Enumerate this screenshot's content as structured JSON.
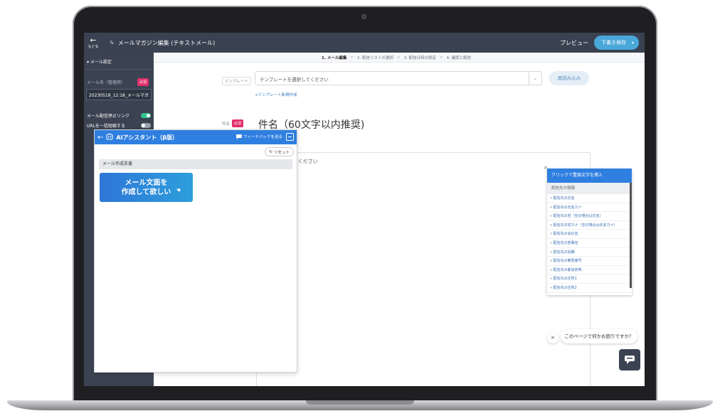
{
  "topbar": {
    "back_label": "もどる",
    "title": "メールマガジン編集 (テキストメール)",
    "preview_label": "プレビュー",
    "save_label": "下書き保存"
  },
  "sidebar": {
    "section_title": "▾ メール設定",
    "mail_name_label": "メール名（管理用）",
    "required_badge": "必須",
    "mail_name_value": "20230518_12:18_メールマガ",
    "toggles": [
      {
        "label": "メール配信停止リンク",
        "state": "on"
      },
      {
        "label": "URLを一括短縮する",
        "state": "off"
      }
    ]
  },
  "steps": {
    "current": "1. メール編集",
    "sep": ">",
    "items": [
      "2. 配信リストの選択",
      "3. 配信日時の設定",
      "4. 確認と配信"
    ]
  },
  "template": {
    "label": "テンプレート",
    "placeholder": "テンプレートを選択してください",
    "reload_label": "再読み込み",
    "new_link": "+テンプレート新規作成"
  },
  "subject": {
    "label": "件名",
    "required_badge": "必須",
    "placeholder": "件名（60文字以内推奨)"
  },
  "body": {
    "placeholder_fragment": "てください"
  },
  "insert_panel": {
    "close": "×",
    "header": "クリックで置換文字を挿入",
    "category": "配信先の情報",
    "items": [
      "« 配信先の氏名",
      "« 配信先の氏名カナ",
      "« 配信先の姓（空の場合は氏名）",
      "« 配信先の姓カナ（空の場合は氏名カナ）",
      "« 配信先の会社名",
      "« 配信先の部署名",
      "« 配信先の役職",
      "« 配信先の郵便番号",
      "« 配信先の都道府県",
      "« 配信先の住所1",
      "« 配信先の住所2"
    ]
  },
  "help": {
    "close": "×",
    "message": "このページで何かお困りですか？"
  },
  "ai_assistant": {
    "title": "AIアシスタント（β版）",
    "feedback_label": "フィードバックを送る",
    "reset_label": "リセット",
    "section_label": "メール作成支援",
    "action_line1": "メール文面を",
    "action_line2": "作成して欲しい"
  },
  "colors": {
    "accent": "#2f7fe0",
    "sidebar_bg": "#3b4352",
    "required": "#e1306c",
    "toggle_on": "#30c48d"
  }
}
